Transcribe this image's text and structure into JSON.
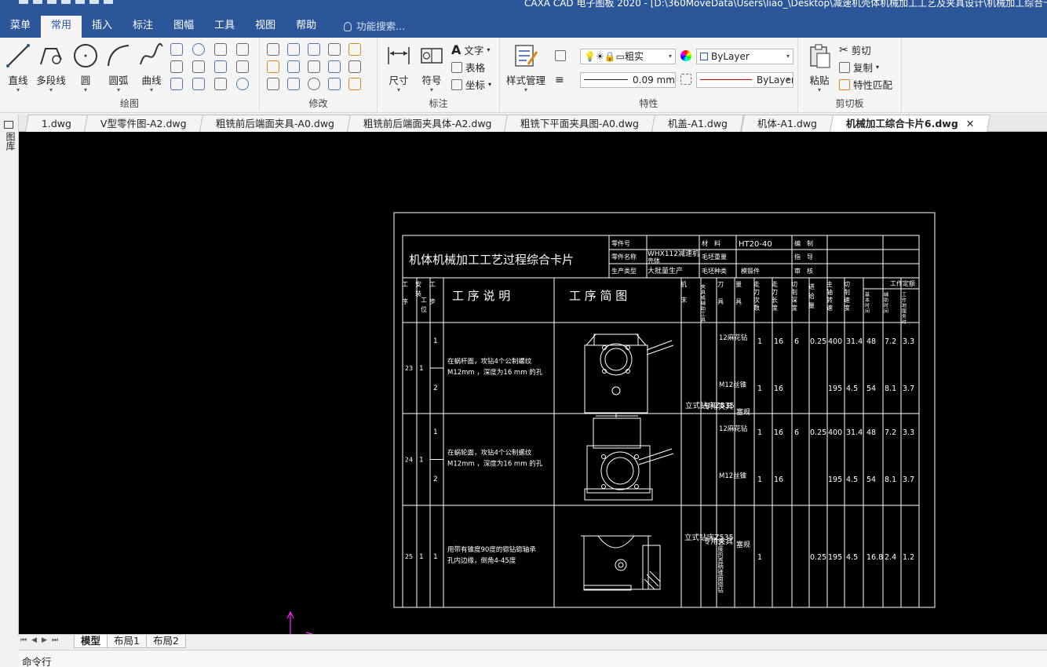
{
  "window": {
    "title": "CAXA CAD 电子图板 2020 - [D:\\360MoveData\\Users\\liao_\\Desktop\\减速机壳体机械加工工艺及夹具设计\\机械加工综合卡片6.dwg]"
  },
  "menubar": {
    "items": [
      "菜单",
      "常用",
      "插入",
      "标注",
      "图幅",
      "工具",
      "视图",
      "帮助"
    ],
    "active": "常用",
    "search_placeholder": "功能搜索..."
  },
  "ribbon": {
    "draw": {
      "label": "绘图",
      "buttons": [
        "直线",
        "多段线",
        "圆",
        "圆弧",
        "曲线"
      ]
    },
    "modify": {
      "label": "修改"
    },
    "annotate": {
      "label": "标注",
      "buttons": [
        "尺寸",
        "符号"
      ],
      "text_btn": "文字",
      "table_btn": "表格",
      "coord_btn": "坐标"
    },
    "properties": {
      "label": "特性",
      "style_btn": "样式管理",
      "layer_value": "粗实",
      "color_value": "ByLayer",
      "lineweight_value": "0.09 mm",
      "linetype_value": "ByLayer"
    },
    "clipboard": {
      "label": "剪切板",
      "paste": "粘贴",
      "cut": "剪切",
      "copy": "复制",
      "match": "特性匹配"
    }
  },
  "doc_tabs": [
    "1.dwg",
    "V型零件图-A2.dwg",
    "粗铣前后端面夹具-A0.dwg",
    "粗铣前后端面夹具体-A2.dwg",
    "粗铣下平面夹具图-A0.dwg",
    "机盖-A1.dwg",
    "机体-A1.dwg",
    "机械加工综合卡片6.dwg"
  ],
  "active_doc": "机械加工综合卡片6.dwg",
  "sidebar_label": "图库",
  "layout_tabs": [
    "模型",
    "布局1",
    "布局2"
  ],
  "command_label": "命令行",
  "card": {
    "title": "机体机械加工工艺过程综合卡片",
    "info": {
      "part_no_label": "零件号",
      "part_name_label": "零件名称",
      "prod_type_label": "生产类型",
      "part_name": "WHX112减速机",
      "part_name_2": "壳体",
      "prod_type": "大批量生产",
      "material_label": "材　料",
      "material": "HT20-40",
      "blank_weight_label": "毛坯重量",
      "blank_type_label": "毛坯种类",
      "blank_type": "模锻件",
      "compile_label": "编　制",
      "guide_label": "指　导",
      "review_label": "审　核"
    },
    "headers": {
      "seq": "工序",
      "install": "安装",
      "install2": "工位",
      "step": "工步",
      "desc": "工 序 说 明",
      "sketch": "工 序 简 图",
      "machine": "机床",
      "fixture": "夹具或辅助工具",
      "tool": "刀具",
      "gauge": "量具",
      "passes": "走刀次数",
      "length": "走刀长度",
      "depth": "切削深度",
      "feed": "进给量",
      "speed": "主轴转速",
      "cutspeed": "切削速度",
      "quota": "工作定额",
      "basic": "基本时间",
      "aux": "辅助时间",
      "place": "工作地服务时"
    },
    "ops": [
      {
        "seq": "23",
        "install": "1",
        "desc1": "在蜗杆面，攻钻4个公制螺纹",
        "desc2": "M12mm ，深度为16 mm 的孔",
        "steps": [
          {
            "step": "1",
            "tool": "12麻花钻",
            "passes": "1",
            "length": "16",
            "depth": "6",
            "feed": "0.25",
            "speed": "400",
            "cut": "31.4",
            "t1": "48",
            "t2": "7.2",
            "t3": "3.3"
          },
          {
            "step": "2",
            "tool": "M12丝锥",
            "passes": "1",
            "length": "16",
            "depth": "",
            "feed": "",
            "speed": "195",
            "cut": "4.5",
            "t1": "54",
            "t2": "8.1",
            "t3": "3.7"
          }
        ]
      },
      {
        "seq": "24",
        "install": "1",
        "desc1": "在蜗轮面，攻钻4个公制螺纹",
        "desc2": "M12mm ，深度为16 mm 的孔",
        "steps": [
          {
            "step": "1",
            "tool": "12麻花钻",
            "passes": "1",
            "length": "16",
            "depth": "6",
            "feed": "0.25",
            "speed": "400",
            "cut": "31.4",
            "t1": "48",
            "t2": "7.2",
            "t3": "3.3"
          },
          {
            "step": "2",
            "tool": "M12丝锥",
            "passes": "1",
            "length": "16",
            "depth": "",
            "feed": "",
            "speed": "195",
            "cut": "4.5",
            "t1": "54",
            "t2": "8.1",
            "t3": "3.7"
          }
        ]
      },
      {
        "seq": "25",
        "install": "1",
        "desc1": "用带有锥度90度的锪钻锪轴承",
        "desc2": "孔内边缘，倒角4-45度",
        "steps": [
          {
            "step": "1",
            "tool": "90度的直柄锥面锪钻",
            "passes": "1",
            "length": "",
            "depth": "",
            "feed": "0.25",
            "speed": "195",
            "cut": "4.5",
            "t1": "16.8",
            "t2": "2.4",
            "t3": "1.2"
          }
        ]
      }
    ],
    "machine": "立式钻床Z535",
    "fixture": "专用夹具",
    "gauge": "塞规"
  }
}
